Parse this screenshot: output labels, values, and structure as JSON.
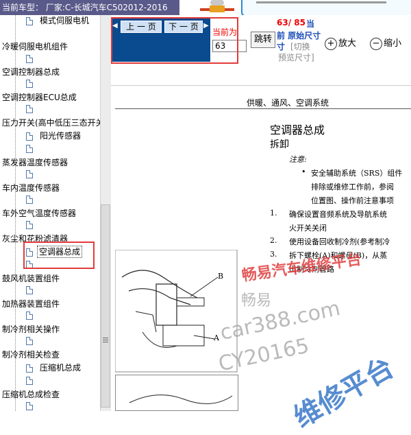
{
  "title": "当前车型：  厂家:C-长城汽车C502012-2016",
  "sidebar": {
    "items": [
      {
        "label": "模式伺服电机",
        "indent": 1
      },
      {
        "label": "冷暖伺服电机组件",
        "indent": 0
      },
      {
        "label": "空调控制器总成",
        "indent": 0
      },
      {
        "label": "空调控制器ECU总成",
        "indent": 0
      },
      {
        "label": "压力开关(高中低压三态开关)",
        "indent": 0
      },
      {
        "label": "阳光传感器",
        "indent": 1
      },
      {
        "label": "蒸发器温度传感器",
        "indent": 0
      },
      {
        "label": "车内温度传感器",
        "indent": 0
      },
      {
        "label": "车外空气温度传感器",
        "indent": 0
      },
      {
        "label": "灰尘和花粉滤清器",
        "indent": 0
      },
      {
        "label": "空调器总成",
        "indent": 1,
        "selected": true
      },
      {
        "label": "鼓风机装置组件",
        "indent": 0
      },
      {
        "label": "加热器装置组件",
        "indent": 0
      },
      {
        "label": "制冷剂相关操作",
        "indent": 0
      },
      {
        "label": "制冷剂相关检查",
        "indent": 0
      },
      {
        "label": "压缩机总成",
        "indent": 1
      },
      {
        "label": "压缩机总成检查",
        "indent": 0
      }
    ]
  },
  "toolbar": {
    "prev_label": "上 一 页",
    "next_label": "下 一 页",
    "current_page_label": "当前为",
    "page_value": "63",
    "jump_label": "跳转",
    "page_counter": "63/ 85",
    "page_counter_suffix": "当",
    "original_size_label": "前 原始尺寸",
    "switch_label": "[切换",
    "preview_label": "预览尺寸]",
    "zoom_in_label": "放大",
    "zoom_out_label": "缩小"
  },
  "document": {
    "header": "供暖、通风、空调系统",
    "title": "空调器总成",
    "subtitle": "拆卸",
    "note_label": "注意:",
    "bullet": "安全辅助系统（SRS）组件",
    "bullet_line2": "排除或维修工作前，参阅",
    "bullet_line3": "位置图、操作前注意事项",
    "step1_num": "1.",
    "step1": "确保设置音频系统及导航系统",
    "step1_line2": "火开关关闭",
    "step2_num": "2.",
    "step2": "使用设备回收制冷剂(参考制冷",
    "step3_num": "3.",
    "step3": "拆下螺栓(A)和螺母(B)，从蒸",
    "step3_line2": "出制冷剂管路",
    "fig_label_a": "A",
    "fig_label_b": "B"
  },
  "watermarks": {
    "brand1": "畅易汽车维修平台",
    "brand2": "畅易",
    "site": "car388.com",
    "id": "CY20165",
    "brand3": "维修平台"
  },
  "colors": {
    "accent_red": "#e23a3a",
    "nav_blue": "#0a4a8e",
    "watermark_red": "#e04040",
    "watermark_blue": "#3a78c8"
  }
}
